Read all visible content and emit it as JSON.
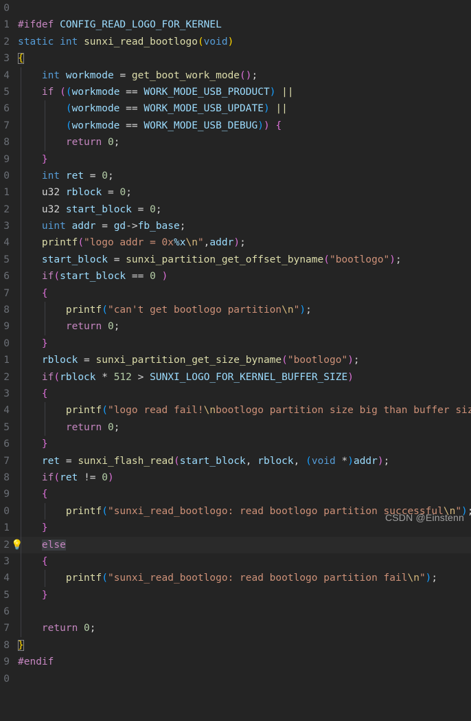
{
  "editor": {
    "language": "c",
    "theme": "dark-plus",
    "background_color": "#242424",
    "gutter_color": "#6b6f76",
    "current_line_color": "#2a2a2a",
    "selection_color": "#3A3D41",
    "indent_guide_color": "#3f4045",
    "bracket_match_outline": "#888888",
    "line_height_px": 24.4,
    "font_size_px": 14.5,
    "first_visible_line": 970,
    "visible_line_count": 31
  },
  "watermark": {
    "text": "CSDN @Einstenn",
    "color": "#A0A0A0"
  },
  "icons": {
    "lightbulb": "💡"
  },
  "lines": [
    {
      "num": "0",
      "text": ""
    },
    {
      "num": "1",
      "text": "#ifdef CONFIG_READ_LOGO_FOR_KERNEL"
    },
    {
      "num": "2",
      "text": "static int sunxi_read_bootlogo(void)"
    },
    {
      "num": "3",
      "text": "{"
    },
    {
      "num": "4",
      "text": "    int workmode = get_boot_work_mode();"
    },
    {
      "num": "5",
      "text": "    if ((workmode == WORK_MODE_USB_PRODUCT) ||"
    },
    {
      "num": "6",
      "text": "        (workmode == WORK_MODE_USB_UPDATE) ||"
    },
    {
      "num": "7",
      "text": "        (workmode == WORK_MODE_USB_DEBUG)) {"
    },
    {
      "num": "8",
      "text": "        return 0;"
    },
    {
      "num": "9",
      "text": "    }"
    },
    {
      "num": "0",
      "text": "    int ret = 0;"
    },
    {
      "num": "1",
      "text": "    u32 rblock = 0;"
    },
    {
      "num": "2",
      "text": "    u32 start_block = 0;"
    },
    {
      "num": "3",
      "text": "    uint addr = gd->fb_base;"
    },
    {
      "num": "4",
      "text": "    printf(\"logo addr = 0x%x\\n\",addr);"
    },
    {
      "num": "5",
      "text": "    start_block = sunxi_partition_get_offset_byname(\"bootlogo\");"
    },
    {
      "num": "6",
      "text": "    if(start_block == 0 )"
    },
    {
      "num": "7",
      "text": "    {"
    },
    {
      "num": "8",
      "text": "        printf(\"can't get bootlogo partition\\n\");"
    },
    {
      "num": "9",
      "text": "        return 0;"
    },
    {
      "num": "0",
      "text": "    }"
    },
    {
      "num": "1",
      "text": "    rblock = sunxi_partition_get_size_byname(\"bootlogo\");"
    },
    {
      "num": "2",
      "text": "    if(rblock * 512 > SUNXI_LOGO_FOR_KERNEL_BUFFER_SIZE)"
    },
    {
      "num": "3",
      "text": "    {"
    },
    {
      "num": "4",
      "text": "        printf(\"logo read fail!\\nbootlogo partition size big than buffer size\\n\");"
    },
    {
      "num": "5",
      "text": "        return 0;"
    },
    {
      "num": "6",
      "text": "    }"
    },
    {
      "num": "7",
      "text": "    ret = sunxi_flash_read(start_block, rblock, (void *)addr);"
    },
    {
      "num": "8",
      "text": "    if(ret != 0)"
    },
    {
      "num": "9",
      "text": "    {"
    },
    {
      "num": "0",
      "text": "        printf(\"sunxi_read_bootlogo: read bootlogo partition successful\\n\");"
    },
    {
      "num": "1",
      "text": "    }"
    },
    {
      "num": "2",
      "text": "    else"
    },
    {
      "num": "3",
      "text": "    {"
    },
    {
      "num": "4",
      "text": "        printf(\"sunxi_read_bootlogo: read bootlogo partition fail\\n\");"
    },
    {
      "num": "5",
      "text": "    }"
    },
    {
      "num": "6",
      "text": ""
    },
    {
      "num": "7",
      "text": "    return 0;"
    },
    {
      "num": "8",
      "text": "}"
    },
    {
      "num": "9",
      "text": "#endif"
    },
    {
      "num": "0",
      "text": ""
    }
  ],
  "annotations": {
    "quick_fix_line_number": "2",
    "quick_fix_keyword": "else",
    "bracket_match_open": "{",
    "bracket_match_close": "}"
  }
}
